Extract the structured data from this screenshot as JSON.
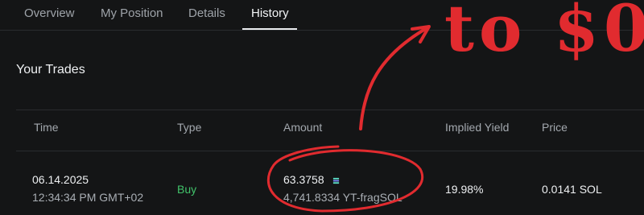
{
  "tabs": [
    {
      "label": "Overview",
      "active": false
    },
    {
      "label": "My Position",
      "active": false
    },
    {
      "label": "Details",
      "active": false
    },
    {
      "label": "History",
      "active": true
    }
  ],
  "section_title": "Your Trades",
  "table": {
    "headers": [
      "Time",
      "Type",
      "Amount",
      "Implied Yield",
      "Price"
    ],
    "rows": [
      {
        "date": "06.14.2025",
        "time": "12:34:34 PM GMT+02",
        "type": "Buy",
        "amount_main": "63.3758",
        "amount_sub": "4,741.8334 YT-fragSOL",
        "implied_yield": "19.98%",
        "price": "0.0141 SOL"
      }
    ]
  },
  "annotation": {
    "text": "to $0",
    "color": "#e12b2f",
    "shapes": [
      "arrow-icon",
      "circle-highlight"
    ]
  },
  "colors": {
    "background": "#141516",
    "buy": "#41c36a",
    "accent_annotation": "#e12b2f"
  },
  "icons": [
    "sol-token-icon"
  ]
}
